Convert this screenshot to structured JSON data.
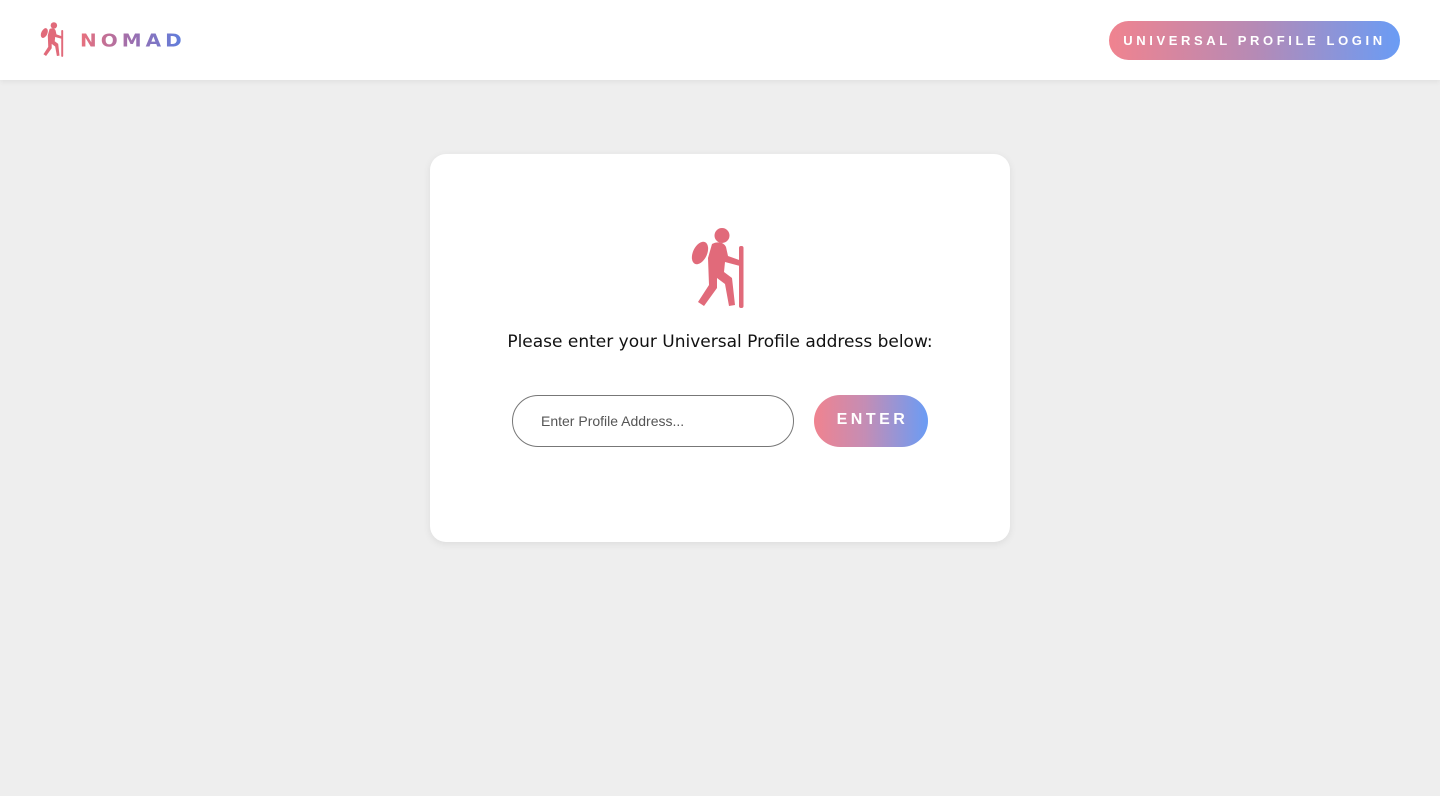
{
  "header": {
    "brand": "NOMAD",
    "logo_icon": "hiker-icon",
    "login_button_label": "UNIVERSAL PROFILE LOGIN"
  },
  "card": {
    "icon": "hiker-icon",
    "prompt": "Please enter your Universal Profile address below:",
    "input": {
      "value": "",
      "placeholder": "Enter Profile Address..."
    },
    "enter_button_label": "ENTER"
  },
  "colors": {
    "page_background": "#eeeeee",
    "icon_color": "#e16a7a",
    "gradient_start": "#f0838f",
    "gradient_end": "#6a9cf5"
  }
}
